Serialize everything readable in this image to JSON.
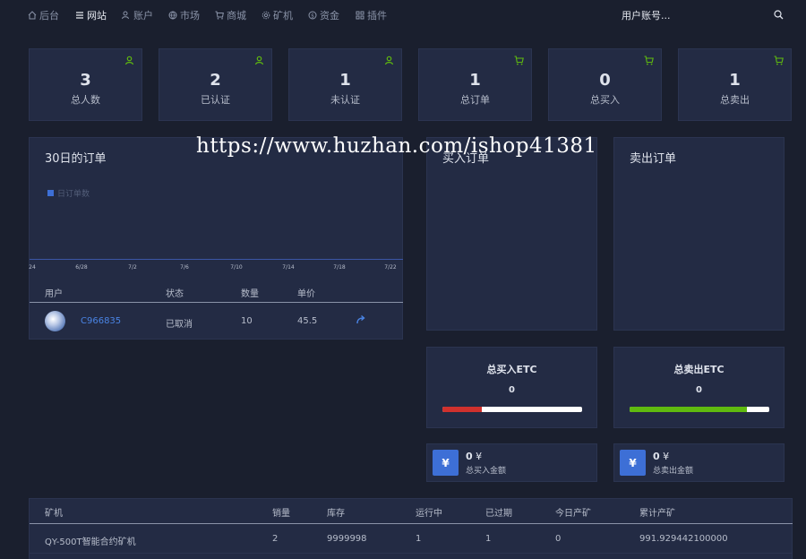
{
  "nav": {
    "items": [
      {
        "label": "后台",
        "icon": "home-icon"
      },
      {
        "label": "网站",
        "icon": "list-icon"
      },
      {
        "label": "账户",
        "icon": "users-icon"
      },
      {
        "label": "市场",
        "icon": "globe-icon"
      },
      {
        "label": "商城",
        "icon": "cart-icon"
      },
      {
        "label": "矿机",
        "icon": "gear-icon"
      },
      {
        "label": "资金",
        "icon": "dollar-icon"
      },
      {
        "label": "插件",
        "icon": "grid-icon"
      }
    ],
    "user_search_placeholder": "用户账号..."
  },
  "stats": [
    {
      "value": "3",
      "label": "总人数",
      "icon": "user-icon"
    },
    {
      "value": "2",
      "label": "已认证",
      "icon": "user-icon"
    },
    {
      "value": "1",
      "label": "未认证",
      "icon": "user-icon"
    },
    {
      "value": "1",
      "label": "总订单",
      "icon": "cart-icon"
    },
    {
      "value": "0",
      "label": "总买入",
      "icon": "cart-icon"
    },
    {
      "value": "1",
      "label": "总卖出",
      "icon": "cart-icon"
    }
  ],
  "orders_chart": {
    "title": "30日的订单",
    "legend": "日订单数",
    "ticks": [
      "24",
      "6/28",
      "7/2",
      "7/6",
      "7/10",
      "7/14",
      "7/18",
      "7/22"
    ]
  },
  "chart_data": {
    "type": "line",
    "title": "30日的订单",
    "series": [
      {
        "name": "日订单数",
        "values": []
      }
    ],
    "x": [
      "24",
      "6/28",
      "7/2",
      "7/6",
      "7/10",
      "7/14",
      "7/18",
      "7/22"
    ],
    "legend_position": "top-left",
    "grid": false
  },
  "orders_table": {
    "headers": [
      "用户",
      "状态",
      "数量",
      "单价"
    ],
    "rows": [
      {
        "user": "C966835",
        "status": "已取消",
        "qty": "10",
        "price": "45.5"
      }
    ]
  },
  "buy_orders": {
    "title": "买入订单"
  },
  "sell_orders": {
    "title": "卖出订单"
  },
  "buy_total": {
    "title": "总买入ETC",
    "value": "0",
    "bar_color": "#d0312d",
    "bar_fraction": 0.28
  },
  "sell_total": {
    "title": "总卖出ETC",
    "value": "0",
    "bar_color": "#5fba0f",
    "bar_fraction": 0.84
  },
  "buy_amount": {
    "icon": "¥",
    "value": "0",
    "currency": "¥",
    "label": "总买入金额"
  },
  "sell_amount": {
    "icon": "¥",
    "value": "0",
    "currency": "¥",
    "label": "总卖出金额"
  },
  "miner_table": {
    "headers": [
      "矿机",
      "销量",
      "库存",
      "运行中",
      "已过期",
      "今日产矿",
      "累计产矿"
    ],
    "rows": [
      [
        "QY-500T智能合约矿机",
        "2",
        "9999998",
        "1",
        "1",
        "0",
        "991.929442100000"
      ]
    ]
  },
  "watermark": "https://www.huzhan.com/ishop41381",
  "colors": {
    "background": "#1a1f2e",
    "panel": "#232b44",
    "accent": "#3d6fd6",
    "green_icon": "#5fba0f"
  }
}
